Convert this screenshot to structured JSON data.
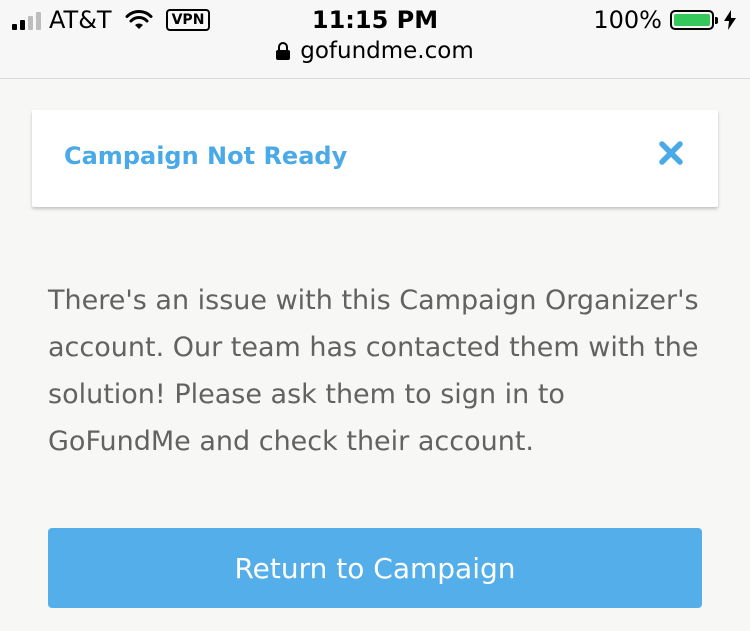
{
  "status_bar": {
    "carrier": "AT&T",
    "vpn_label": "VPN",
    "time": "11:15 PM",
    "battery_percent_label": "100%",
    "battery_level": 1.0
  },
  "address_bar": {
    "domain": "gofundme.com"
  },
  "alert": {
    "title": "Campaign Not Ready",
    "close_icon": "close-x-icon",
    "message": "There's an issue with this Campaign Organizer's account. Our team has contacted them with the solution! Please ask them to sign in to GoFundMe and check their account."
  },
  "actions": {
    "return_label": "Return to Campaign"
  },
  "colors": {
    "accent_text": "#4aa9e7",
    "button": "#53aeea",
    "battery": "#35c759"
  }
}
